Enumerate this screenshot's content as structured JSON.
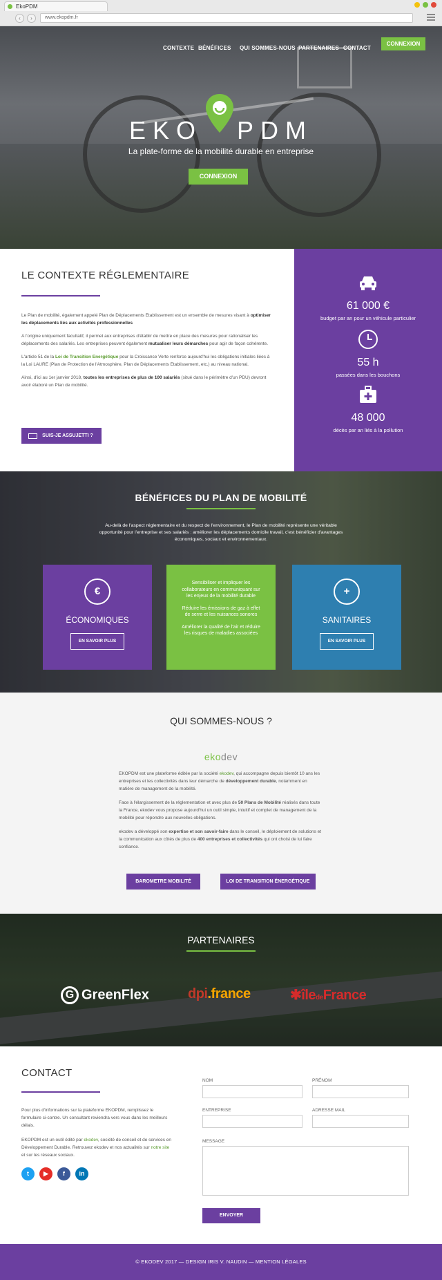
{
  "browser": {
    "tab_title": "EkoPDM",
    "url": "www.ekopdm.fr"
  },
  "nav": {
    "items": [
      "CONTEXTE",
      "BÉNÉFICES",
      "QUI SOMMES-NOUS",
      "PARTENAIRES",
      "CONTACT"
    ],
    "connect": "CONNEXION"
  },
  "hero": {
    "logo_left": "EKO",
    "logo_right": "PDM",
    "tagline": "La plate-forme de la mobilité durable en entreprise",
    "button": "CONNEXION"
  },
  "context": {
    "title": "LE CONTEXTE RÉGLEMENTAIRE",
    "p1a": "Le Plan de mobilité, également appelé Plan de Déplacements Etablissement est un ensemble de mesures visant à ",
    "p1b": "optimiser les déplacements liés aux activités professionnelles",
    "p2a": "A l'origine uniquement facultatif, il permet aux entreprises d'établir de mettre en place des mesures pour rationaliser les déplacements des salariés. Les entreprises peuvent également ",
    "p2b": "mutualiser leurs démarches",
    "p2c": " pour agir de façon cohérente.",
    "p3a": "L'article 51 de la ",
    "p3b": "Loi de Transition Energétique",
    "p3c": " pour la Croissance Verte renforce aujourd'hui les obligations initiales liées à la Loi LAURE (Plan de Protection de l'Atmosphère, Plan de Déplacements Etablissement, etc.) au niveau national.",
    "p4a": "Ainsi, d'ici au 1er janvier 2018, ",
    "p4b": "toutes les entreprises de plus de 100 salariés",
    "p4c": " (situé dans le périmètre d'un PDU) devront avoir élaboré un Plan de mobilité.",
    "button": "SUIS-JE ASSUJETTI ?"
  },
  "stats": [
    {
      "icon": "car-icon",
      "value": "61 000 €",
      "label": "budget par an pour un véhicule particulier"
    },
    {
      "icon": "clock-icon",
      "value": "55 h",
      "label": "passées dans les bouchons"
    },
    {
      "icon": "medkit-icon",
      "value": "48 000",
      "label": "décès par an liés à la pollution"
    }
  ],
  "benefits": {
    "title": "BÉNÉFICES DU PLAN DE MOBILITÉ",
    "intro": "Au-delà de l'aspect réglementaire et du respect de l'environnement, le Plan de mobilité représente une véritable opportunité pour l'entreprise et ses salariés : améliorer les déplacements domicile travail, c'est bénéficier d'avantages économiques, sociaux et environnementaux.",
    "card1": {
      "symbol": "€",
      "title": "ÉCONOMIQUES",
      "button": "EN SAVOIR PLUS"
    },
    "card2": {
      "p1": "Sensibiliser et impliquer les collaborateurs en communiquant sur les enjeux de la mobilité durable",
      "p2": "Réduire les émissions de gaz à effet de serre et les nuisances sonores",
      "p3": "Améliorer la qualité de l'air et réduire les risques de maladies associées"
    },
    "card3": {
      "symbol": "+",
      "title": "SANITAIRES",
      "button": "EN SAVOIR PLUS"
    }
  },
  "about": {
    "title": "QUI SOMMES-NOUS ?",
    "logo_a": "eko",
    "logo_b": "dev",
    "p1a": "EKOPDM est une plateforme éditée par la société ",
    "p1b": "ekodev",
    "p1c": ", qui accompagne depuis bientôt 10 ans les entreprises et les collectivités dans leur démarche de ",
    "p1d": "développement durable",
    "p1e": ", notamment en matière de management de la mobilité.",
    "p2a": "Face à l'élargissement de la réglementation et avec plus de ",
    "p2b": "50 Plans de Mobilité",
    "p2c": " réalisés dans toute la France, ekodev vous propose aujourd'hui un outil simple, intuitif et complet de management de la mobilité pour répondre aux nouvelles obligations.",
    "p3a": "ekodev a développé son ",
    "p3b": "expertise et son savoir-faire",
    "p3c": " dans le conseil, le déploiement de solutions et la communication aux côtés de plus de ",
    "p3d": "400 entreprises et collectivités",
    "p3e": " qui ont choisi de lui faire confiance.",
    "button1": "BAROMETRE MOBILITÉ",
    "button2": "LOI DE TRANSITION ÉNERGÉTIQUE"
  },
  "partners": {
    "title": "PARTENAIRES",
    "greenflex": "GreenFlex",
    "greenflex_mark": "G",
    "dpf_a": "dpi",
    "dpf_b": ".france",
    "idf_a": "île",
    "idf_b": "de",
    "idf_c": "France"
  },
  "contact": {
    "title": "CONTACT",
    "p1": "Pour plus d'informations sur la plateforme EKOPDM, remplissez le formulaire ci-contre. Un consultant reviendra vers vous dans les meilleurs délais.",
    "p2a": "EKOPDM est un outil édité par ",
    "p2b": "ekodev",
    "p2c": ", société de conseil et de services en Développement Durable. Retrouvez ekodev et nos actualités sur ",
    "p2d": "notre site",
    "p2e": " et sur les réseaux sociaux.",
    "social": [
      "t",
      "▶",
      "f",
      "in"
    ],
    "form": {
      "nom": "NOM",
      "prenom": "PRÉNOM",
      "entreprise": "ENTREPRISE",
      "email": "ADRESSE MAIL",
      "message": "MESSAGE",
      "submit": "ENVOYER"
    }
  },
  "footer": {
    "text": "© EKODEV 2017 — DESIGN IRIS V. NAUDIN — MENTION LÉGALES"
  },
  "colors": {
    "purple": "#6b3fa0",
    "green": "#7ac143",
    "blue": "#2e7fb0"
  }
}
